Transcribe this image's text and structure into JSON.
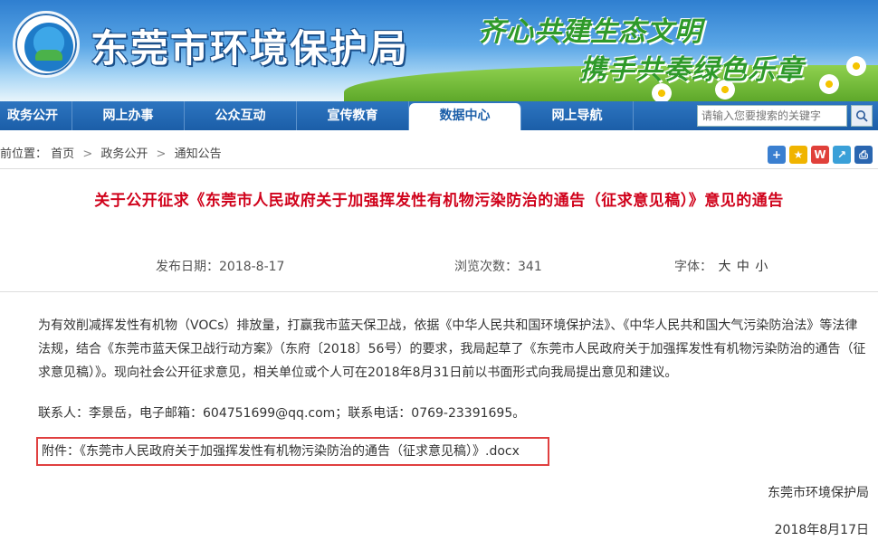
{
  "header": {
    "site_title": "东莞市环境保护局",
    "slogan_line1": "齐心共建生态文明",
    "slogan_line2": "携手共奏绿色乐章"
  },
  "nav": {
    "items": [
      {
        "label": "政务公开",
        "active": false
      },
      {
        "label": "网上办事",
        "active": false
      },
      {
        "label": "公众互动",
        "active": false
      },
      {
        "label": "宣传教育",
        "active": false
      },
      {
        "label": "数据中心",
        "active": true
      },
      {
        "label": "网上导航",
        "active": false
      }
    ],
    "search_placeholder": "请输入您要搜索的关键字",
    "search_icon": "search-icon"
  },
  "breadcrumb": {
    "prefix": "前位置：",
    "items": [
      "首页",
      "政务公开",
      "通知公告"
    ],
    "separator": ">"
  },
  "tools": [
    "add-icon",
    "favorite-icon",
    "weibo-icon",
    "share-icon",
    "print-icon"
  ],
  "article": {
    "title": "关于公开征求《东莞市人民政府关于加强挥发性有机物污染防治的通告（征求意见稿）》意见的通告",
    "publish_date_label": "发布日期：2018-8-17",
    "views_label": "浏览次数：341",
    "font_label": "字体：",
    "font_sizes": [
      "大",
      "中",
      "小"
    ],
    "body": "为有效削减挥发性有机物（VOCs）排放量，打赢我市蓝天保卫战，依据《中华人民共和国环境保护法》、《中华人民共和国大气污染防治法》等法律法规，结合《东莞市蓝天保卫战行动方案》（东府〔2018〕56号）的要求，我局起草了《东莞市人民政府关于加强挥发性有机物污染防治的通告（征求意见稿）》。现向社会公开征求意见，相关单位或个人可在2018年8月31日前以书面形式向我局提出意见和建议。",
    "contact": "联系人：李景岳，电子邮箱：604751699@qq.com；联系电话：0769-23391695。",
    "attachment_prefix": "附件：",
    "attachment_link": "《东莞市人民政府关于加强挥发性有机物污染防治的通告（征求意见稿）》.docx",
    "signature": "东莞市环境保护局",
    "date": "2018年8月17日"
  }
}
